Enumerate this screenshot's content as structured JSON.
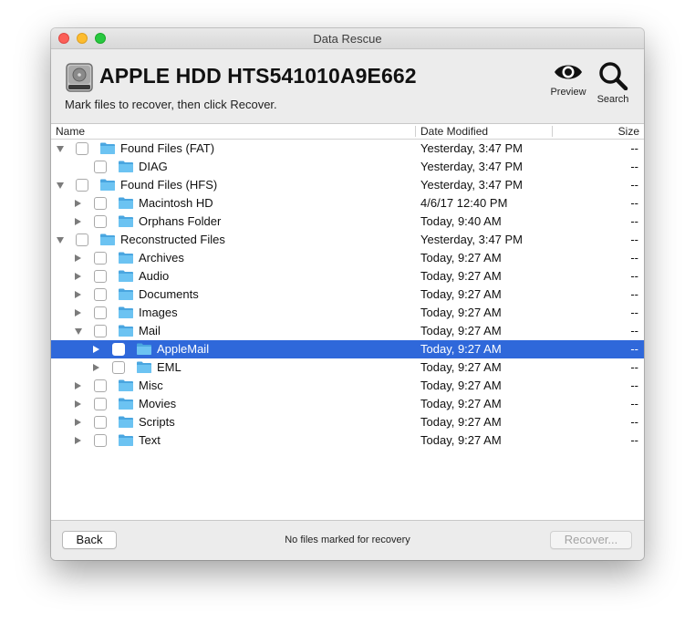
{
  "window": {
    "title": "Data Rescue"
  },
  "header": {
    "disk_name": "APPLE HDD HTS541010A9E662",
    "instruction": "Mark files to recover, then click Recover.",
    "preview_label": "Preview",
    "search_label": "Search"
  },
  "columns": {
    "name": "Name",
    "date": "Date Modified",
    "size": "Size"
  },
  "rows": [
    {
      "name": "Found Files (FAT)",
      "date": "Yesterday, 3:47 PM",
      "size": "--",
      "level": 0,
      "disclosure": "open",
      "selected": false
    },
    {
      "name": "DIAG",
      "date": "Yesterday, 3:47 PM",
      "size": "--",
      "level": 1,
      "disclosure": "none",
      "selected": false
    },
    {
      "name": "Found Files (HFS)",
      "date": "Yesterday, 3:47 PM",
      "size": "--",
      "level": 0,
      "disclosure": "open",
      "selected": false
    },
    {
      "name": "Macintosh HD",
      "date": "4/6/17 12:40 PM",
      "size": "--",
      "level": 1,
      "disclosure": "closed",
      "selected": false
    },
    {
      "name": "Orphans Folder",
      "date": "Today, 9:40 AM",
      "size": "--",
      "level": 1,
      "disclosure": "closed",
      "selected": false
    },
    {
      "name": "Reconstructed Files",
      "date": "Yesterday, 3:47 PM",
      "size": "--",
      "level": 0,
      "disclosure": "open",
      "selected": false
    },
    {
      "name": "Archives",
      "date": "Today, 9:27 AM",
      "size": "--",
      "level": 1,
      "disclosure": "closed",
      "selected": false
    },
    {
      "name": "Audio",
      "date": "Today, 9:27 AM",
      "size": "--",
      "level": 1,
      "disclosure": "closed",
      "selected": false
    },
    {
      "name": "Documents",
      "date": "Today, 9:27 AM",
      "size": "--",
      "level": 1,
      "disclosure": "closed",
      "selected": false
    },
    {
      "name": "Images",
      "date": "Today, 9:27 AM",
      "size": "--",
      "level": 1,
      "disclosure": "closed",
      "selected": false
    },
    {
      "name": "Mail",
      "date": "Today, 9:27 AM",
      "size": "--",
      "level": 1,
      "disclosure": "open",
      "selected": false
    },
    {
      "name": "AppleMail",
      "date": "Today, 9:27 AM",
      "size": "--",
      "level": 2,
      "disclosure": "closed",
      "selected": true
    },
    {
      "name": "EML",
      "date": "Today, 9:27 AM",
      "size": "--",
      "level": 2,
      "disclosure": "closed",
      "selected": false
    },
    {
      "name": "Misc",
      "date": "Today, 9:27 AM",
      "size": "--",
      "level": 1,
      "disclosure": "closed",
      "selected": false
    },
    {
      "name": "Movies",
      "date": "Today, 9:27 AM",
      "size": "--",
      "level": 1,
      "disclosure": "closed",
      "selected": false
    },
    {
      "name": "Scripts",
      "date": "Today, 9:27 AM",
      "size": "--",
      "level": 1,
      "disclosure": "closed",
      "selected": false
    },
    {
      "name": "Text",
      "date": "Today, 9:27 AM",
      "size": "--",
      "level": 1,
      "disclosure": "closed",
      "selected": false
    }
  ],
  "footer": {
    "back_label": "Back",
    "status": "No files marked for recovery",
    "recover_label": "Recover..."
  },
  "colors": {
    "selection": "#2f68da",
    "folder": "#6cc3f2",
    "folder_dark": "#4aa6e0"
  }
}
